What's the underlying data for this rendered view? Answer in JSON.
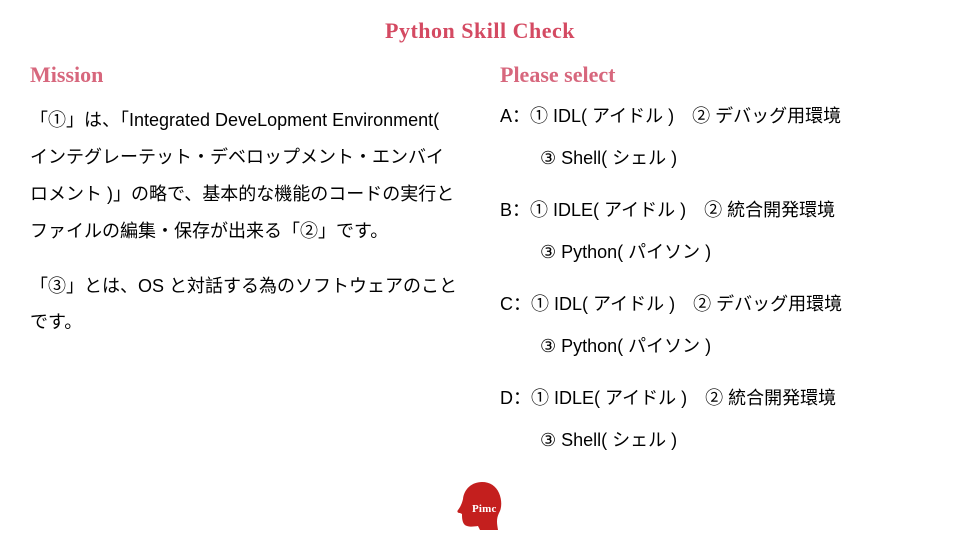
{
  "title": "Python Skill Check",
  "mission": {
    "heading": "Mission",
    "p1": "「①」は、「Integrated DeveLopment Environment( インテグレーテット・デベロップメント・エンバイロメント )」の略で、基本的な機能のコードの実行とファイルの編集・保存が出来る「②」です。",
    "p2": "「③」とは、OS と対話する為のソフトウェアのことです。"
  },
  "select": {
    "heading": "Please select",
    "options": [
      {
        "key": "A",
        "line1": "A：① IDL( アイドル )　② デバッグ用環境",
        "line2": "③ Shell( シェル )"
      },
      {
        "key": "B",
        "line1": "B：① IDLE( アイドル )　② 統合開発環境",
        "line2": "③ Python( パイソン )"
      },
      {
        "key": "C",
        "line1": "C：① IDL( アイドル )　② デバッグ用環境",
        "line2": "③ Python( パイソン )"
      },
      {
        "key": "D",
        "line1": "D：① IDLE( アイドル )　② 統合開発環境",
        "line2": "③ Shell( シェル )"
      }
    ]
  },
  "footer": {
    "logo_text": "Pimc",
    "logo_color": "#c41f1e"
  }
}
